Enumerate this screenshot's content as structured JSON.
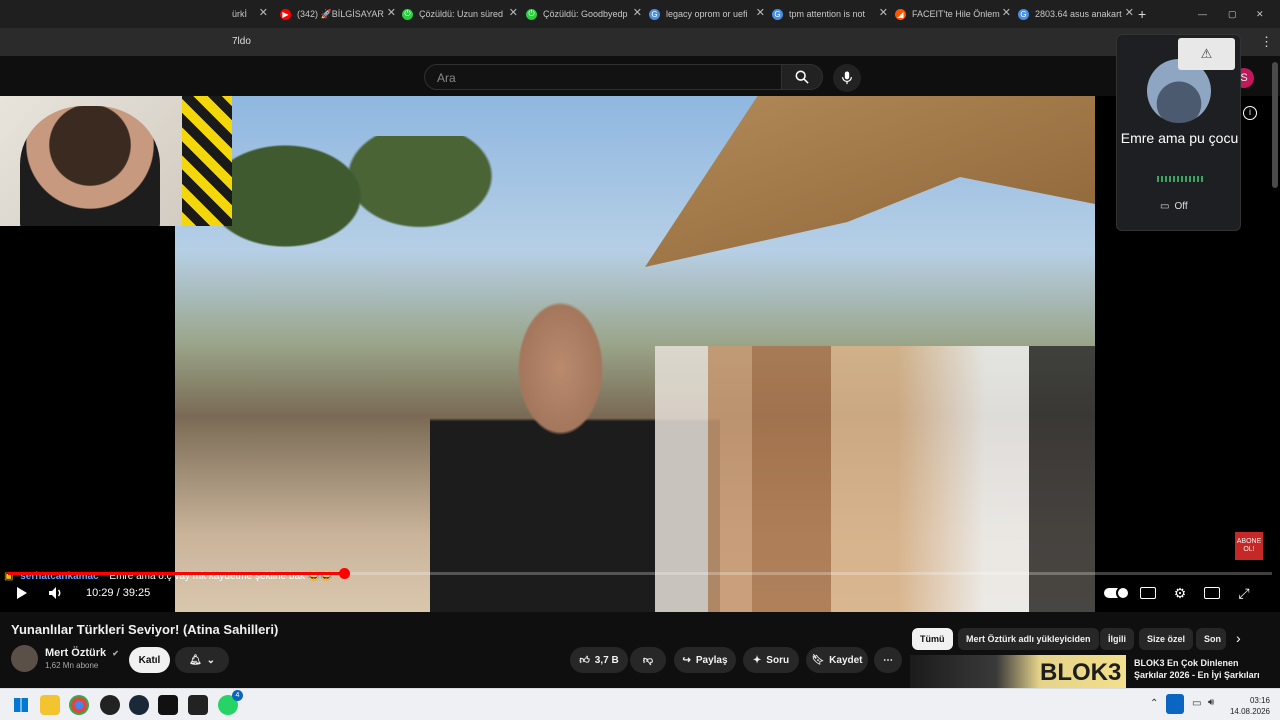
{
  "browser": {
    "tabs": [
      {
        "title": "ürkİ",
        "fav_color": "#555",
        "fav_glyph": ""
      },
      {
        "title": "(342) 🚀BİLGİSAYAR",
        "fav_color": "#ff0000",
        "fav_glyph": "▶"
      },
      {
        "title": "Çözüldü: Uzun süred",
        "fav_color": "#2ecc40",
        "fav_glyph": "⏻"
      },
      {
        "title": "Çözüldü: Goodbyedp",
        "fav_color": "#2ecc40",
        "fav_glyph": "⏻"
      },
      {
        "title": "legacy oprom or uefi",
        "fav_color": "#4a90e2",
        "fav_glyph": "G"
      },
      {
        "title": "tpm attention is not",
        "fav_color": "#4a90e2",
        "fav_glyph": "G"
      },
      {
        "title": "FACEIT'te Hile Önlem",
        "fav_color": "#ff5500",
        "fav_glyph": "◢"
      },
      {
        "title": "2803.64 asus anakart",
        "fav_color": "#4a90e2",
        "fav_glyph": "G"
      }
    ],
    "new_tab": "+",
    "address_fragment": "7ldo",
    "window_controls": [
      "—",
      "▢",
      "✕"
    ]
  },
  "youtube": {
    "search": {
      "placeholder": "Ara"
    },
    "video": {
      "title": "Yunanlılar Türkleri Seviyor! (Atina Sahilleri)",
      "time_current": "10:29",
      "time_total": "39:25",
      "time_display": "10:29 / 39:25",
      "progress_fraction": 0.266
    },
    "channel": {
      "name": "Mert Öztürk",
      "verified_icon": "✔",
      "subscribers": "1,62 Mn abone",
      "join_label": "Katıl"
    },
    "actions": {
      "likes": "3,7 B",
      "share": "Paylaş",
      "ask": "Soru",
      "save": "Kaydet"
    },
    "chips": [
      "Tümü",
      "Mert Öztürk adlı yükleyiciden",
      "İlgili",
      "Size özel",
      "Son"
    ],
    "recommended": {
      "title": "BLOK3 En Çok Dinlenen Şarkılar 2026 - En İyi Şarkıları",
      "thumb_text": "BLOK3"
    },
    "subscribe_badge": "ABONE OL!"
  },
  "stream_overlay": {
    "chat_user": "serhatcankamac",
    "chat_message": "Emre ama o.ç vay mk kaydetme şekline bak 😂😂"
  },
  "voice_overlay": {
    "name": "Emre ama pu çocu",
    "camera_label": "Off"
  },
  "taskbar": {
    "time": "03:16",
    "date": "14.08.2026",
    "whatsapp_badge": "4"
  }
}
